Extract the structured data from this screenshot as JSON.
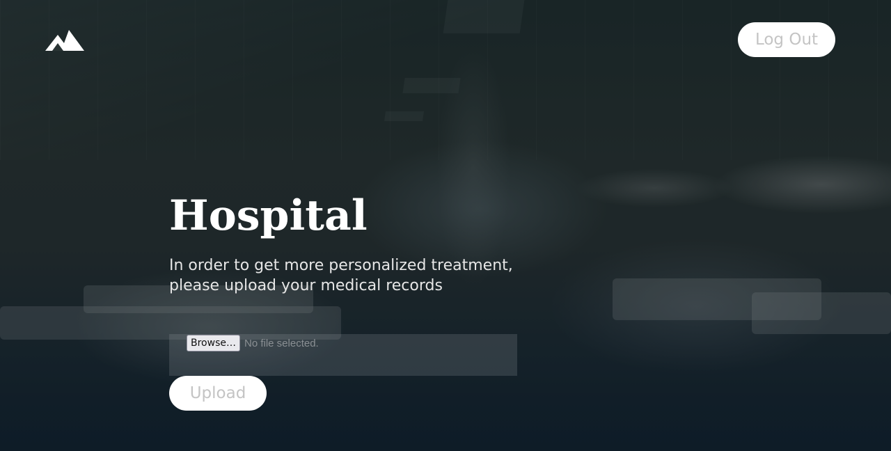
{
  "app": {
    "logo_icon": "mountain-logo-icon"
  },
  "header": {
    "logout_label": "Log Out"
  },
  "main": {
    "title": "Hospital",
    "subtitle": "In order to get more personalized treatment, please upload your medical records",
    "file_input": {
      "browse_label": "Browse…",
      "status_text": "No file selected."
    },
    "upload_label": "Upload"
  },
  "colors": {
    "button_bg": "#ffffff",
    "button_text": "#c4c4c4",
    "title": "#ffffff",
    "subtitle": "#e6e6e6"
  }
}
